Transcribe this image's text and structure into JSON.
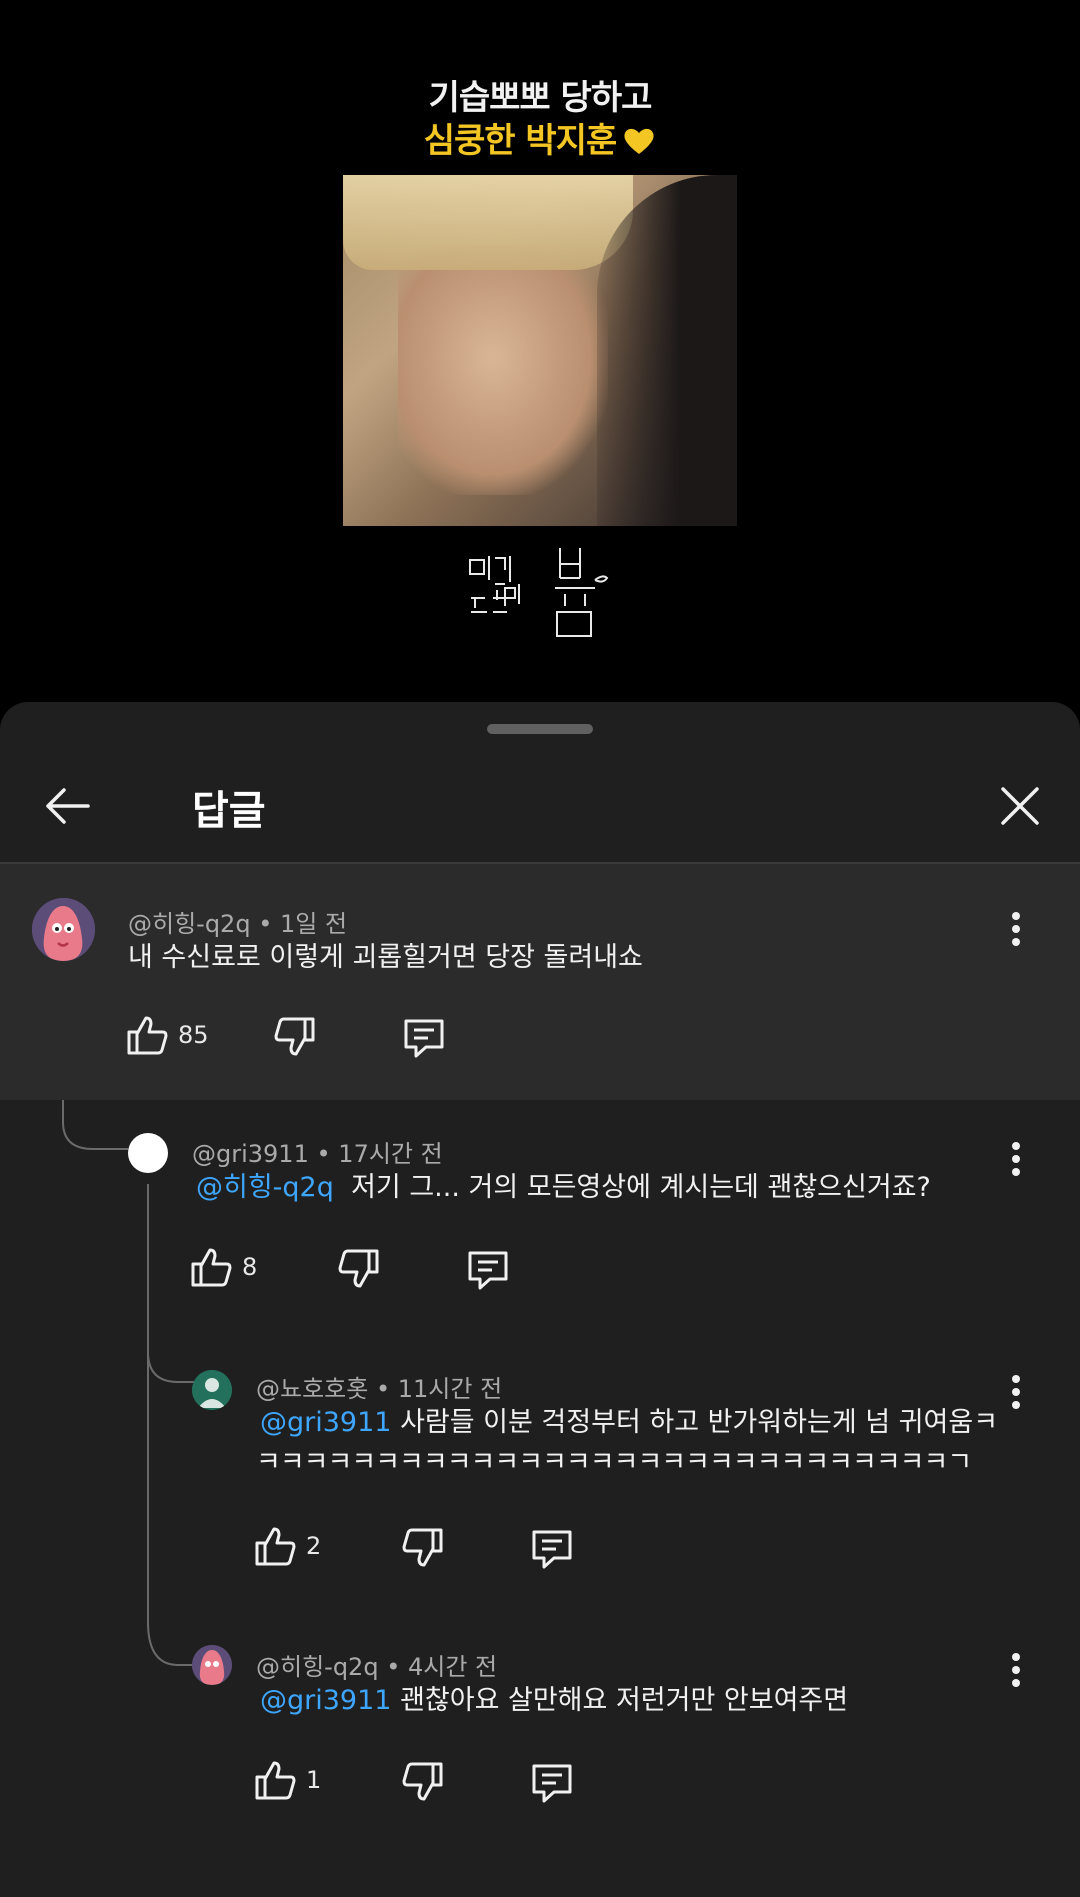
{
  "video": {
    "title_line1": "기습뽀뽀 당하고",
    "title_line2": "심쿵한 박지훈"
  },
  "sheet": {
    "title": "답글"
  },
  "comments": [
    {
      "author": "@히힝-q2q",
      "time": "1일 전",
      "mention": "",
      "text": "내 수신료로 이렇게 괴롭힐거면 당장 돌려내쇼",
      "likes": "85"
    },
    {
      "author": "@gri3911",
      "time": "17시간 전",
      "mention": "@히힝-q2q",
      "text": "저기 그... 거의 모든영상에 계시는데 괜찮으신거죠?",
      "likes": "8"
    },
    {
      "author": "@뇨호호홋",
      "time": "11시간 전",
      "mention": "@gri3911",
      "text": "사람들 이분 걱정부터 하고 반가워하는게 넘 귀여움ㅋ",
      "text2": "ㅋㅋㅋㅋㅋㅋㅋㅋㅋㅋㅋㅋㅋㅋㅋㅋㅋㅋㅋㅋㅋㅋㅋㅋㅋㅋㅋㅋㅋㄱ",
      "likes": "2"
    },
    {
      "author": "@히힝-q2q",
      "time": "4시간 전",
      "mention": "@gri3911",
      "text": "괜찮아요 살만해요 저런거만 안보여주면",
      "likes": "1"
    }
  ],
  "separator": "•",
  "colors": {
    "mention": "#3ea6ff",
    "accent_title": "#f3c623"
  },
  "icons": [
    "back-arrow-icon",
    "close-icon",
    "more-vert-icon",
    "thumb-up-icon",
    "thumb-down-icon",
    "reply-icon",
    "heart-icon"
  ]
}
